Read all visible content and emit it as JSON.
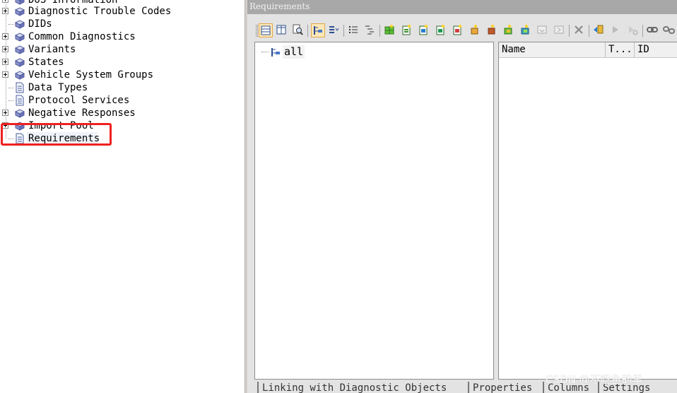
{
  "tree": {
    "items": [
      {
        "label": "DoS Information",
        "icon": "cube-folder-icon",
        "expandable": true
      },
      {
        "label": "Diagnostic Trouble Codes",
        "icon": "cube-folder-icon",
        "expandable": true
      },
      {
        "label": "DIDs",
        "icon": "cube-folder-icon",
        "expandable": false
      },
      {
        "label": "Common Diagnostics",
        "icon": "cube-folder-icon",
        "expandable": true
      },
      {
        "label": "Variants",
        "icon": "cube-folder-icon",
        "expandable": true
      },
      {
        "label": "States",
        "icon": "cube-folder-icon",
        "expandable": true
      },
      {
        "label": "Vehicle System Groups",
        "icon": "cube-folder-icon",
        "expandable": true
      },
      {
        "label": "Data Types",
        "icon": "document-icon",
        "expandable": false
      },
      {
        "label": "Protocol Services",
        "icon": "document-icon",
        "expandable": false
      },
      {
        "label": "Negative Responses",
        "icon": "cube-folder-icon",
        "expandable": true
      },
      {
        "label": "Import Pool",
        "icon": "cube-folder-icon",
        "expandable": true
      },
      {
        "label": "Requirements",
        "icon": "document-icon",
        "expandable": false
      }
    ],
    "selected": "Requirements"
  },
  "panel": {
    "title": "Requirements"
  },
  "toolbar": {
    "buttons": [
      "view-rows-icon",
      "view-columns-icon",
      "find-icon",
      "tree-view-icon",
      "expand-all-icon",
      "list-icon",
      "outline-icon",
      "add-grid-icon",
      "new-doc-1-icon",
      "new-doc-2-icon",
      "new-doc-3-icon",
      "new-doc-4-icon",
      "new-star-1-icon",
      "new-star-2-icon",
      "new-star-3-icon",
      "new-star-4-icon",
      "import-icon",
      "export-icon",
      "delete-icon",
      "link-icon",
      "forward-icon",
      "forward-disabled-icon",
      "chain-icon",
      "unlink-icon"
    ]
  },
  "req_tree": {
    "root_label": "all"
  },
  "req_list": {
    "columns": [
      "Name",
      "T...",
      "ID"
    ]
  },
  "bottom_tabs": [
    "Linking with Diagnostic Objects",
    "Properties",
    "Columns",
    "Settings"
  ],
  "watermark": "CSDN @不吃鱼的羊",
  "colors": {
    "selection_outline": "#f02020",
    "title_bar": "#a8a8a8",
    "panel_background": "#e3e3e3"
  }
}
